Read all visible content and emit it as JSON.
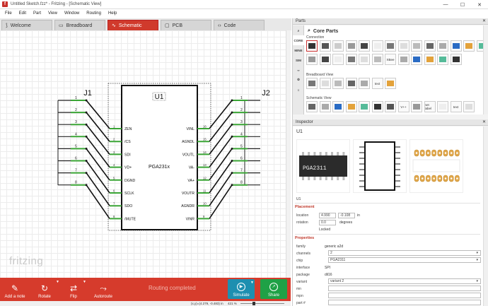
{
  "window": {
    "title": "Untitled Sketch.fzz* - Fritzing - [Schematic View]",
    "app_icon_letter": "f",
    "controls": [
      "—",
      "☐",
      "✕"
    ]
  },
  "menu": [
    "File",
    "Edit",
    "Part",
    "View",
    "Window",
    "Routing",
    "Help"
  ],
  "tabs": [
    {
      "label": "Welcome",
      "icon": "⟆",
      "active": false
    },
    {
      "label": "Breadboard",
      "icon": "▭",
      "active": false
    },
    {
      "label": "Schematic",
      "icon": "∿",
      "active": true
    },
    {
      "label": "PCB",
      "icon": "▢",
      "active": false
    },
    {
      "label": "Code",
      "icon": "‹›",
      "active": false
    }
  ],
  "schematic": {
    "j1_label": "J1",
    "j2_label": "J2",
    "chip_ref": "U1",
    "chip_name": "PGA231x",
    "left_pins": [
      "ZEN",
      "/CS",
      "SDI",
      "VD+",
      "DGND",
      "SCLK",
      "SDO",
      "/MUTE"
    ],
    "right_pins": [
      "VINL",
      "AGNDL",
      "VOUTL",
      "VA-",
      "VA+",
      "VOUTR",
      "AGNDR",
      "VINR"
    ],
    "left_pin_numbers": [
      "1",
      "2",
      "3",
      "4",
      "5",
      "6",
      "7",
      "8"
    ],
    "right_pin_numbers": [
      "16",
      "15",
      "14",
      "13",
      "12",
      "11",
      "10",
      "9"
    ],
    "j1_numbers": [
      "1",
      "2",
      "3",
      "4",
      "5",
      "6",
      "7",
      "8"
    ],
    "j2_numbers": [
      "1",
      "2",
      "3",
      "4",
      "5",
      "6",
      "7",
      "8"
    ],
    "wire_color": "#3aa535"
  },
  "watermark": "fritzing",
  "toolbar": {
    "add_note": "Add a note",
    "rotate": "Rotate",
    "flip": "Flip",
    "autoroute": "Autoroute",
    "routing_status": "Routing completed",
    "simulate": "Simulate",
    "share": "Share"
  },
  "status": {
    "coords": "(x,y)=(4.279, -0.483) in",
    "zoom": "421 %"
  },
  "parts_panel": {
    "header": "Parts",
    "bin_title": "Core Parts",
    "section_connection": "Connection",
    "section_breadboard": "Breadboard View",
    "section_schematic": "Schematic View",
    "bins": [
      "CORE",
      "MINE",
      "SIM",
      "∞",
      "⚙",
      "≡",
      "🔍"
    ],
    "tile_text": "text",
    "net_label": "net label",
    "vcc_label": "V++",
    "note_label": "Note",
    "xbee_label": "XBee"
  },
  "inspector": {
    "header": "Inspector",
    "title": "U1",
    "small_label": "U1",
    "ic_text": "PGA2311",
    "placement_label": "Placement",
    "location_label": "location",
    "location_x": "4.990",
    "location_y": "-0.108",
    "location_unit": "in",
    "rotation_label": "rotation",
    "rotation_value": "0.0",
    "rotation_unit": "degrees",
    "locked_label": "Locked",
    "properties_label": "Properties",
    "properties": [
      {
        "key": "family",
        "value": "generic a2d",
        "type": "text"
      },
      {
        "key": "channels",
        "value": "2",
        "type": "select"
      },
      {
        "key": "chip",
        "value": "PGA2311",
        "type": "select"
      },
      {
        "key": "interface",
        "value": "SPI",
        "type": "text"
      },
      {
        "key": "package",
        "value": "dil16",
        "type": "text"
      },
      {
        "key": "variant",
        "value": "variant 2",
        "type": "select"
      },
      {
        "key": "mn",
        "value": "",
        "type": "input"
      },
      {
        "key": "mpn",
        "value": "",
        "type": "input"
      },
      {
        "key": "part #",
        "value": "",
        "type": "input"
      }
    ]
  },
  "colors": {
    "accent_red": "#d63b2c",
    "simulate_blue": "#1d8fb0",
    "share_green": "#1fa146",
    "wire_green": "#3aa535"
  }
}
